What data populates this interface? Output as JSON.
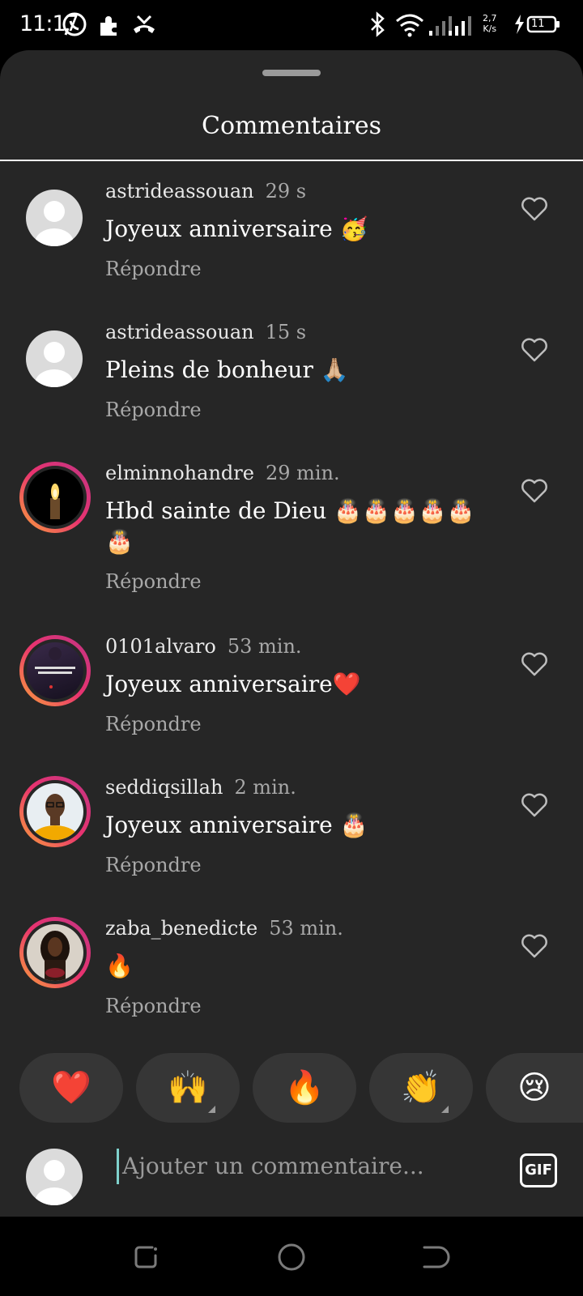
{
  "status_bar": {
    "time": "11:17",
    "speed_value": "2,7",
    "speed_unit": "K/s",
    "battery": "11"
  },
  "sheet": {
    "title": "Commentaires"
  },
  "comments": [
    {
      "user": "astrideassouan",
      "time": "29 s",
      "text": "Joyeux anniversaire 🥳",
      "reply": "Répondre",
      "avatar": "default"
    },
    {
      "user": "astrideassouan",
      "time": "15 s",
      "text": "Pleins de bonheur 🙏🏼",
      "reply": "Répondre",
      "avatar": "default"
    },
    {
      "user": "elminnohandre",
      "time": "29 min.",
      "text": "Hbd sainte de Dieu 🎂🎂🎂🎂🎂🎂",
      "reply": "Répondre",
      "avatar": "candle"
    },
    {
      "user": "0101alvaro",
      "time": "53 min.",
      "text": "Joyeux anniversaire❤️",
      "reply": "Répondre",
      "avatar": "photo-dark"
    },
    {
      "user": "seddiqsillah",
      "time": "2 min.",
      "text": "Joyeux anniversaire 🎂",
      "reply": "Répondre",
      "avatar": "photo-man"
    },
    {
      "user": "zaba_benedicte",
      "time": "53 min.",
      "text": "🔥",
      "reply": "Répondre",
      "avatar": "photo-woman"
    }
  ],
  "reactions": [
    "❤️",
    "🙌",
    "🔥",
    "👏",
    "😢"
  ],
  "composer": {
    "placeholder": "Ajouter un commentaire...",
    "gif_label": "GIF"
  },
  "colors": {
    "sheet_bg": "#262626",
    "accent_cursor": "#7fd1cc",
    "ring_start": "#f9a33a",
    "ring_end": "#c13584"
  }
}
